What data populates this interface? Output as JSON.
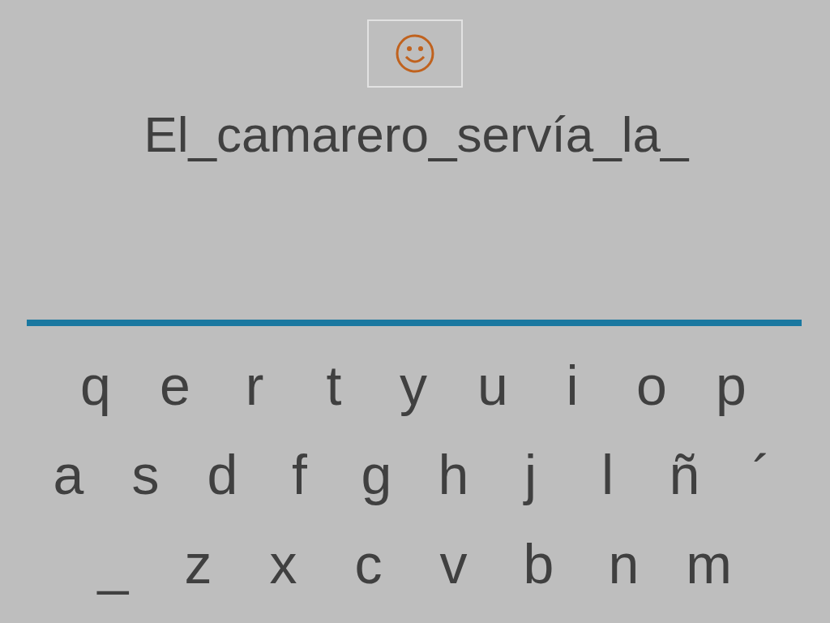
{
  "sentence": "El_camarero_servía_la_",
  "keyboard": {
    "rows": [
      [
        "q",
        "e",
        "r",
        "t",
        "y",
        "u",
        "i",
        "o",
        "p"
      ],
      [
        "a",
        "s",
        "d",
        "f",
        "g",
        "h",
        "j",
        "l",
        "ñ",
        "´"
      ],
      [
        "_",
        "z",
        "x",
        "c",
        "v",
        "b",
        "n",
        "m"
      ]
    ]
  }
}
